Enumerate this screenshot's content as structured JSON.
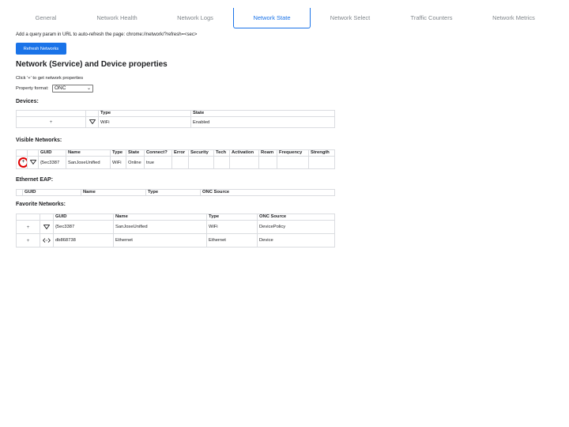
{
  "tabs": [
    {
      "label": "General"
    },
    {
      "label": "Network Health"
    },
    {
      "label": "Network Logs"
    },
    {
      "label": "Network State"
    },
    {
      "label": "Network Select"
    },
    {
      "label": "Traffic Counters"
    },
    {
      "label": "Network Metrics"
    }
  ],
  "active_tab": "Network State",
  "hint_text": "Add a query param in URL to auto-refresh the page: chrome://network/?refresh=<sec>",
  "refresh_button": "Refresh Networks",
  "section_title": "Network (Service) and Device properties",
  "click_hint": "Click '+' to get network properties",
  "property_format_label": "Property format:",
  "property_format_value": "ONC",
  "devices": {
    "heading": "Devices:",
    "headers": [
      "",
      "",
      "Type",
      "State"
    ],
    "rows": [
      {
        "expand": "+",
        "icon": "wifi-icon",
        "type": "WiFi",
        "state": "Enabled"
      }
    ]
  },
  "visible_networks": {
    "heading": "Visible Networks:",
    "headers": [
      "",
      "",
      "GUID",
      "Name",
      "Type",
      "State",
      "Connect?",
      "Error",
      "Security",
      "Tech",
      "Activation",
      "Roam",
      "Frequency",
      "Strength"
    ],
    "rows": [
      {
        "expand": "+",
        "icon": "wifi-icon",
        "guid": "{5ec3387",
        "name": "SanJoseUnified",
        "type": "WiFi",
        "state": "Online",
        "connect": "true",
        "error": "",
        "security": "",
        "tech": "",
        "activation": "",
        "roam": "",
        "frequency": "",
        "strength": ""
      }
    ]
  },
  "ethernet_eap": {
    "heading": "Ethernet EAP:",
    "headers": [
      "",
      "GUID",
      "Name",
      "Type",
      "ONC Source"
    ]
  },
  "favorite_networks": {
    "heading": "Favorite Networks:",
    "headers": [
      "",
      "",
      "GUID",
      "Name",
      "Type",
      "ONC Source"
    ],
    "rows": [
      {
        "expand": "+",
        "icon": "wifi-icon",
        "guid": "{5ec3387",
        "name": "SanJoseUnified",
        "type": "WiFi",
        "source": "DevicePolicy"
      },
      {
        "expand": "+",
        "icon": "ethernet-icon",
        "guid": "db868738",
        "name": "Ethernet",
        "type": "Ethernet",
        "source": "Device"
      }
    ]
  }
}
